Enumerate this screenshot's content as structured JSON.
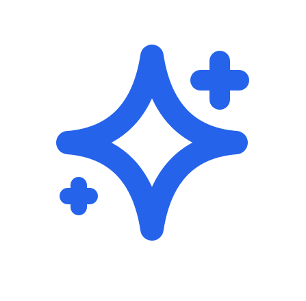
{
  "icon": {
    "name": "sparkles-icon",
    "color": "#2563EB",
    "background": "#FFFFFF"
  }
}
